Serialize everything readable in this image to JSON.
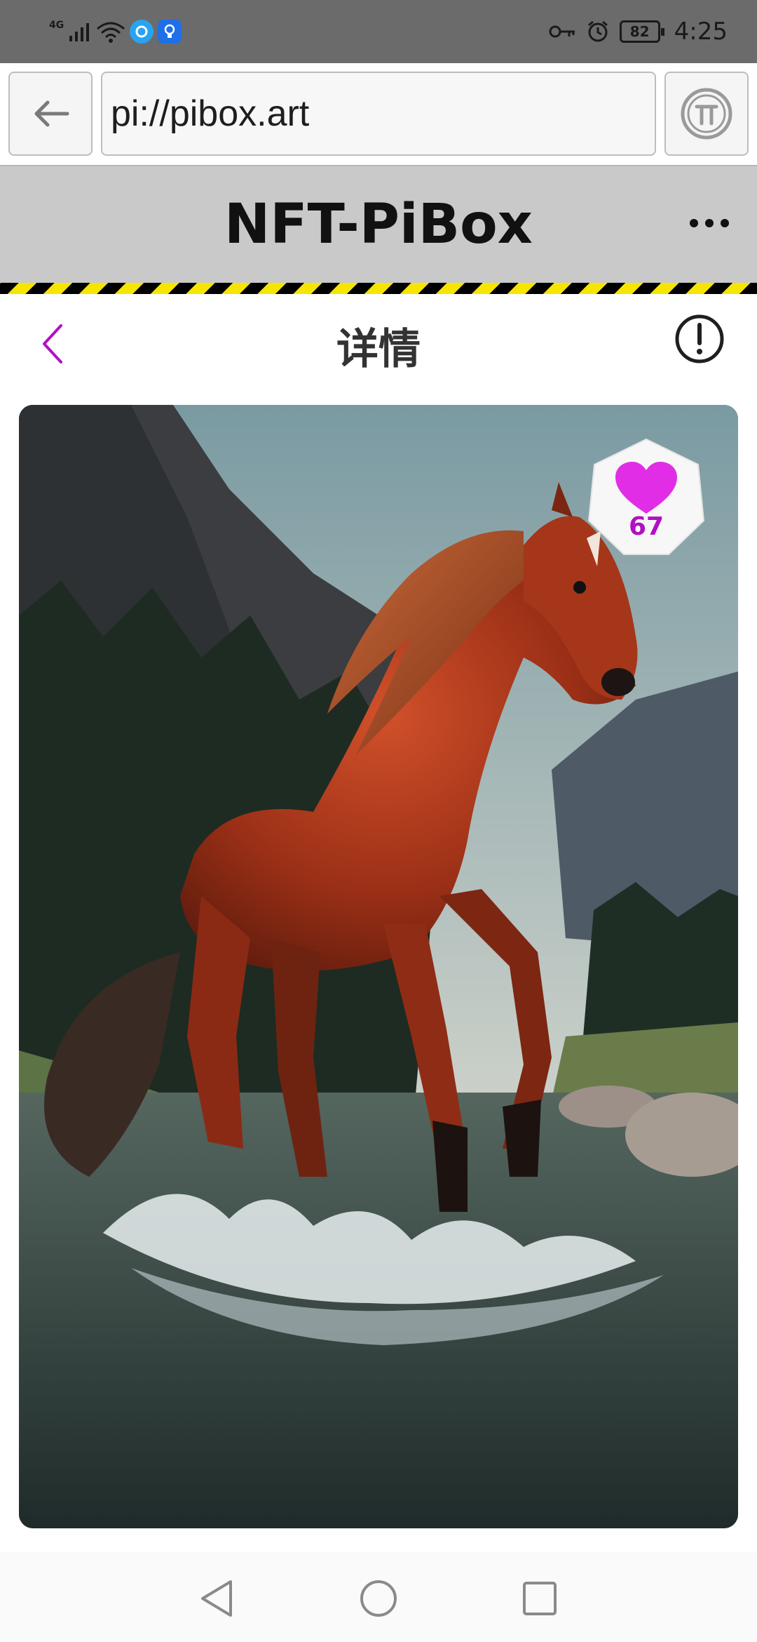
{
  "status_bar": {
    "network_label": "4G",
    "battery": "82",
    "time": "4:25",
    "icons": [
      "signal-icon",
      "wifi-icon",
      "app-icon",
      "lightbulb-app-icon",
      "key-icon",
      "alarm-icon",
      "battery-icon"
    ]
  },
  "browser": {
    "url": "pi://pibox.art",
    "back_icon": "arrow-left-icon",
    "pi_icon": "pi-logo-icon"
  },
  "header": {
    "title": "NFT-PiBox",
    "more_icon": "more-dots-icon"
  },
  "detail": {
    "title": "详情",
    "back_icon": "chevron-left-icon",
    "report_icon": "exclamation-circle-icon"
  },
  "artwork": {
    "likes": "67",
    "like_icon": "heart-icon"
  },
  "system_nav": {
    "icons": [
      "back-triangle-icon",
      "home-circle-icon",
      "recents-square-icon"
    ]
  },
  "colors": {
    "accent": "#b10fc4",
    "heart": "#e12ee6",
    "header_bg": "#c9c9c9",
    "hazard_yellow": "#f5e500"
  }
}
